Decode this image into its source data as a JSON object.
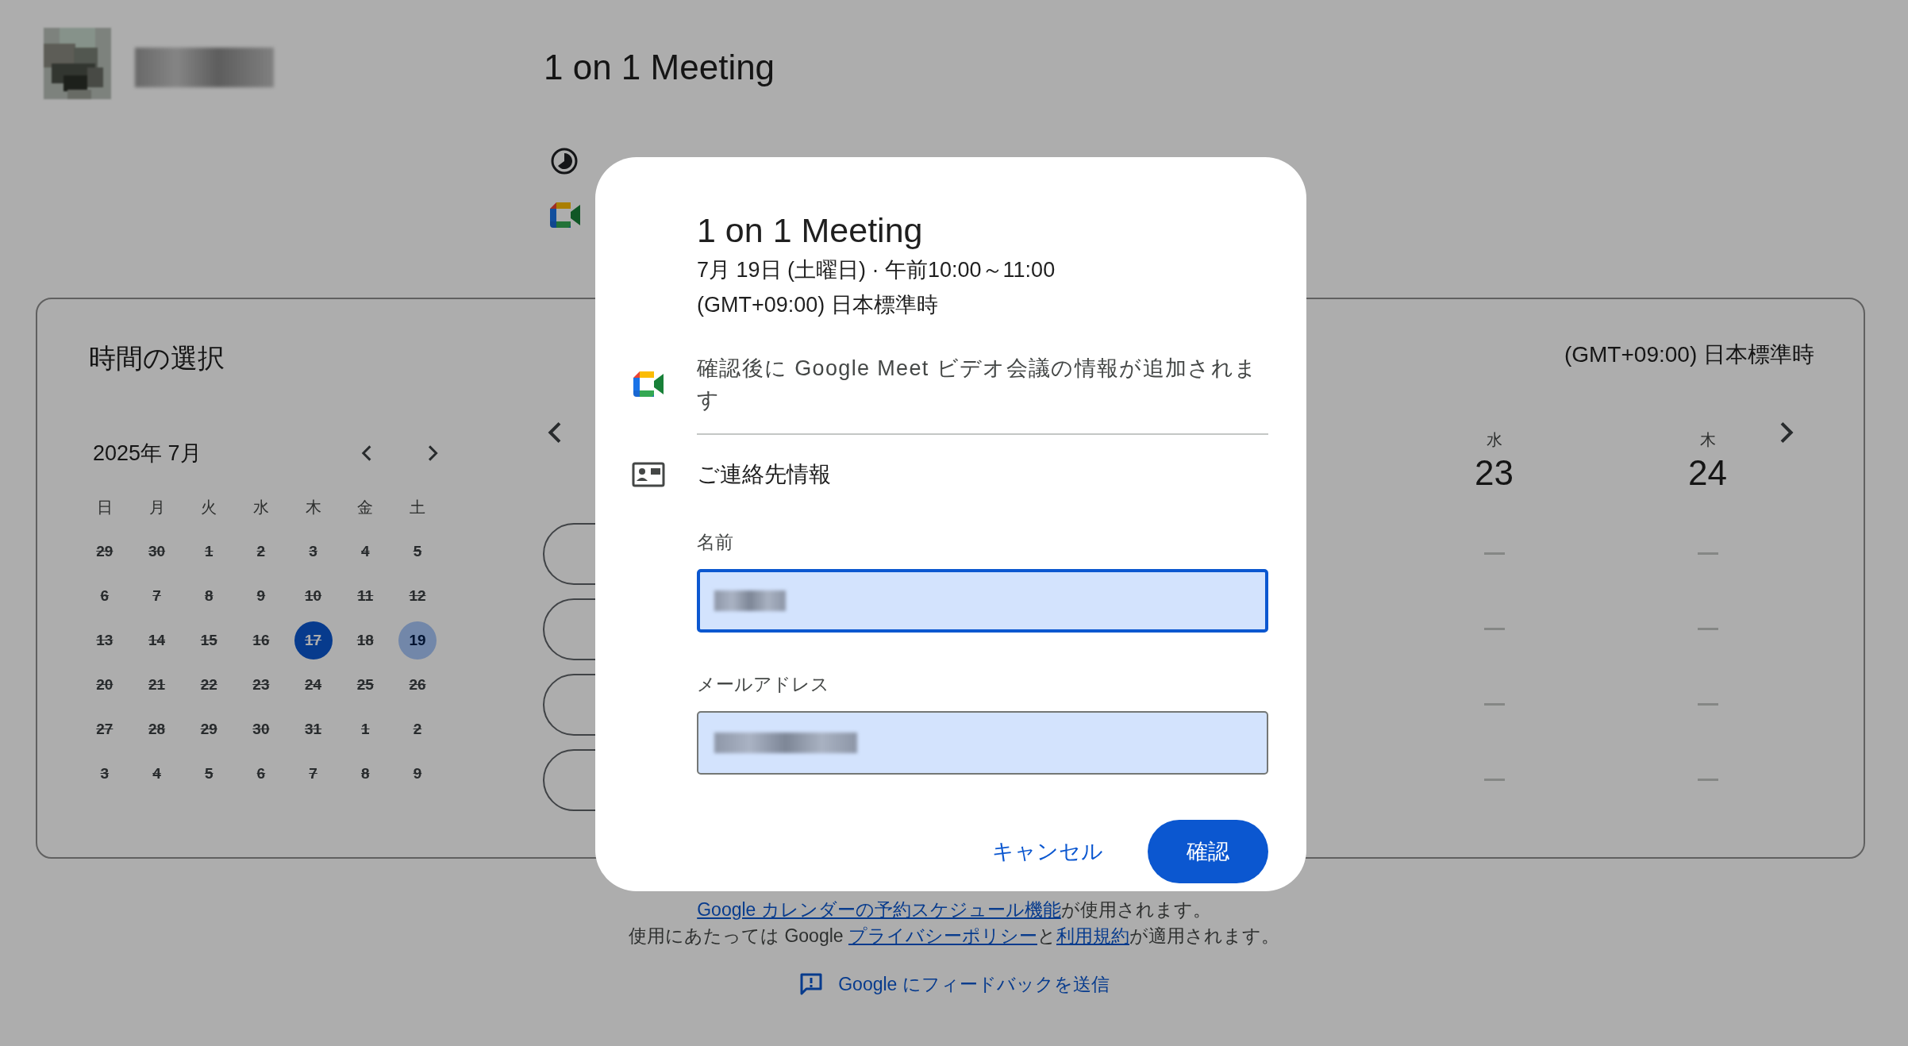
{
  "header": {
    "title": "1 on 1 Meeting"
  },
  "scheduler": {
    "title": "時間の選択",
    "timezone": "(GMT+09:00) 日本標準時",
    "mini_calendar": {
      "month": "2025年 7月",
      "weekdays": [
        "日",
        "月",
        "火",
        "水",
        "木",
        "金",
        "土"
      ],
      "days": [
        {
          "label": "29",
          "disabled": true,
          "today": false,
          "selected": false
        },
        {
          "label": "30",
          "disabled": true,
          "today": false,
          "selected": false
        },
        {
          "label": "1",
          "disabled": true,
          "today": false,
          "selected": false
        },
        {
          "label": "2",
          "disabled": true,
          "today": false,
          "selected": false
        },
        {
          "label": "3",
          "disabled": true,
          "today": false,
          "selected": false
        },
        {
          "label": "4",
          "disabled": true,
          "today": false,
          "selected": false
        },
        {
          "label": "5",
          "disabled": true,
          "today": false,
          "selected": false
        },
        {
          "label": "6",
          "disabled": true,
          "today": false,
          "selected": false
        },
        {
          "label": "7",
          "disabled": true,
          "today": false,
          "selected": false
        },
        {
          "label": "8",
          "disabled": true,
          "today": false,
          "selected": false
        },
        {
          "label": "9",
          "disabled": true,
          "today": false,
          "selected": false
        },
        {
          "label": "10",
          "disabled": true,
          "today": false,
          "selected": false
        },
        {
          "label": "11",
          "disabled": true,
          "today": false,
          "selected": false
        },
        {
          "label": "12",
          "disabled": true,
          "today": false,
          "selected": false
        },
        {
          "label": "13",
          "disabled": true,
          "today": false,
          "selected": false
        },
        {
          "label": "14",
          "disabled": true,
          "today": false,
          "selected": false
        },
        {
          "label": "15",
          "disabled": true,
          "today": false,
          "selected": false
        },
        {
          "label": "16",
          "disabled": true,
          "today": false,
          "selected": false
        },
        {
          "label": "17",
          "disabled": true,
          "today": true,
          "selected": false
        },
        {
          "label": "18",
          "disabled": true,
          "today": false,
          "selected": false
        },
        {
          "label": "19",
          "disabled": false,
          "today": false,
          "selected": true
        },
        {
          "label": "20",
          "disabled": true,
          "today": false,
          "selected": false
        },
        {
          "label": "21",
          "disabled": true,
          "today": false,
          "selected": false
        },
        {
          "label": "22",
          "disabled": true,
          "today": false,
          "selected": false
        },
        {
          "label": "23",
          "disabled": true,
          "today": false,
          "selected": false
        },
        {
          "label": "24",
          "disabled": true,
          "today": false,
          "selected": false
        },
        {
          "label": "25",
          "disabled": true,
          "today": false,
          "selected": false
        },
        {
          "label": "26",
          "disabled": true,
          "today": false,
          "selected": false
        },
        {
          "label": "27",
          "disabled": true,
          "today": false,
          "selected": false
        },
        {
          "label": "28",
          "disabled": true,
          "today": false,
          "selected": false
        },
        {
          "label": "29",
          "disabled": true,
          "today": false,
          "selected": false
        },
        {
          "label": "30",
          "disabled": true,
          "today": false,
          "selected": false
        },
        {
          "label": "31",
          "disabled": true,
          "today": false,
          "selected": false
        },
        {
          "label": "1",
          "disabled": true,
          "today": false,
          "selected": false
        },
        {
          "label": "2",
          "disabled": true,
          "today": false,
          "selected": false
        },
        {
          "label": "3",
          "disabled": true,
          "today": false,
          "selected": false
        },
        {
          "label": "4",
          "disabled": true,
          "today": false,
          "selected": false
        },
        {
          "label": "5",
          "disabled": true,
          "today": false,
          "selected": false
        },
        {
          "label": "6",
          "disabled": true,
          "today": false,
          "selected": false
        },
        {
          "label": "7",
          "disabled": true,
          "today": false,
          "selected": false
        },
        {
          "label": "8",
          "disabled": true,
          "today": false,
          "selected": false
        },
        {
          "label": "9",
          "disabled": true,
          "today": false,
          "selected": false
        }
      ]
    },
    "week": {
      "columns": [
        {
          "slots": [
            {
              "kind": "time"
            },
            {
              "kind": "time"
            },
            {
              "kind": "time"
            },
            {
              "kind": "time"
            }
          ]
        },
        {
          "weekday": "水",
          "date": "23",
          "slots": [
            {
              "kind": "none"
            },
            {
              "kind": "none"
            },
            {
              "kind": "none"
            },
            {
              "kind": "none"
            }
          ]
        },
        {
          "weekday": "木",
          "date": "24",
          "slots": [
            {
              "kind": "none"
            },
            {
              "kind": "none"
            },
            {
              "kind": "none"
            },
            {
              "kind": "none"
            }
          ]
        }
      ]
    }
  },
  "dialog": {
    "title": "1 on 1 Meeting",
    "when": "7月 19日 (土曜日) · 午前10:00～11:00",
    "timezone": "(GMT+09:00) 日本標準時",
    "meet_note": "確認後に Google Meet ビデオ会議の情報が追加されます",
    "contact_heading": "ご連絡先情報",
    "fields": [
      {
        "label": "名前",
        "focused": true
      },
      {
        "label": "メールアドレス",
        "focused": false
      }
    ],
    "buttons": [
      {
        "label": "キャンセル",
        "kind": "text"
      },
      {
        "label": "確認",
        "kind": "filled"
      }
    ]
  },
  "footer": {
    "lines": [
      [
        {
          "text": "Google カレンダーの予約スケジュール機能",
          "link": true
        },
        {
          "text": "が使用されます。",
          "link": false
        }
      ],
      [
        {
          "text": "使用にあたっては Google ",
          "link": false
        },
        {
          "text": "プライバシーポリシー",
          "link": true
        },
        {
          "text": "と",
          "link": false
        },
        {
          "text": "利用規約",
          "link": true
        },
        {
          "text": "が適用されます。",
          "link": false
        }
      ]
    ],
    "feedback": "Google にフィードバックを送信"
  }
}
